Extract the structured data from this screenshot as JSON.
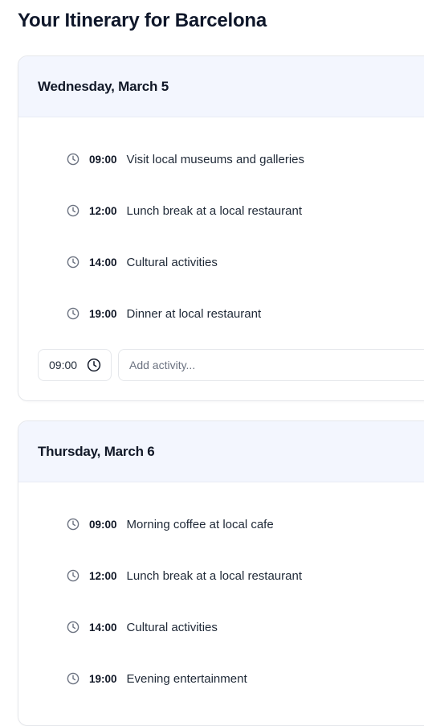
{
  "page": {
    "title": "Your Itinerary for Barcelona"
  },
  "days": [
    {
      "title": "Wednesday, March 5",
      "activities": [
        {
          "time": "09:00",
          "desc": "Visit local museums and galleries"
        },
        {
          "time": "12:00",
          "desc": "Lunch break at a local restaurant"
        },
        {
          "time": "14:00",
          "desc": "Cultural activities"
        },
        {
          "time": "19:00",
          "desc": "Dinner at local restaurant"
        }
      ],
      "add": {
        "time_value": "09:00",
        "activity_placeholder": "Add activity..."
      }
    },
    {
      "title": "Thursday, March 6",
      "activities": [
        {
          "time": "09:00",
          "desc": "Morning coffee at local cafe"
        },
        {
          "time": "12:00",
          "desc": "Lunch break at a local restaurant"
        },
        {
          "time": "14:00",
          "desc": "Cultural activities"
        },
        {
          "time": "19:00",
          "desc": "Evening entertainment"
        }
      ]
    }
  ],
  "icons": {
    "activity_icon": "clock-icon",
    "time_picker_icon": "clock-icon"
  },
  "colors": {
    "header_bg": "#f3f6fe",
    "border": "#e5e7eb",
    "text": "#111827",
    "placeholder": "#6b7280"
  }
}
